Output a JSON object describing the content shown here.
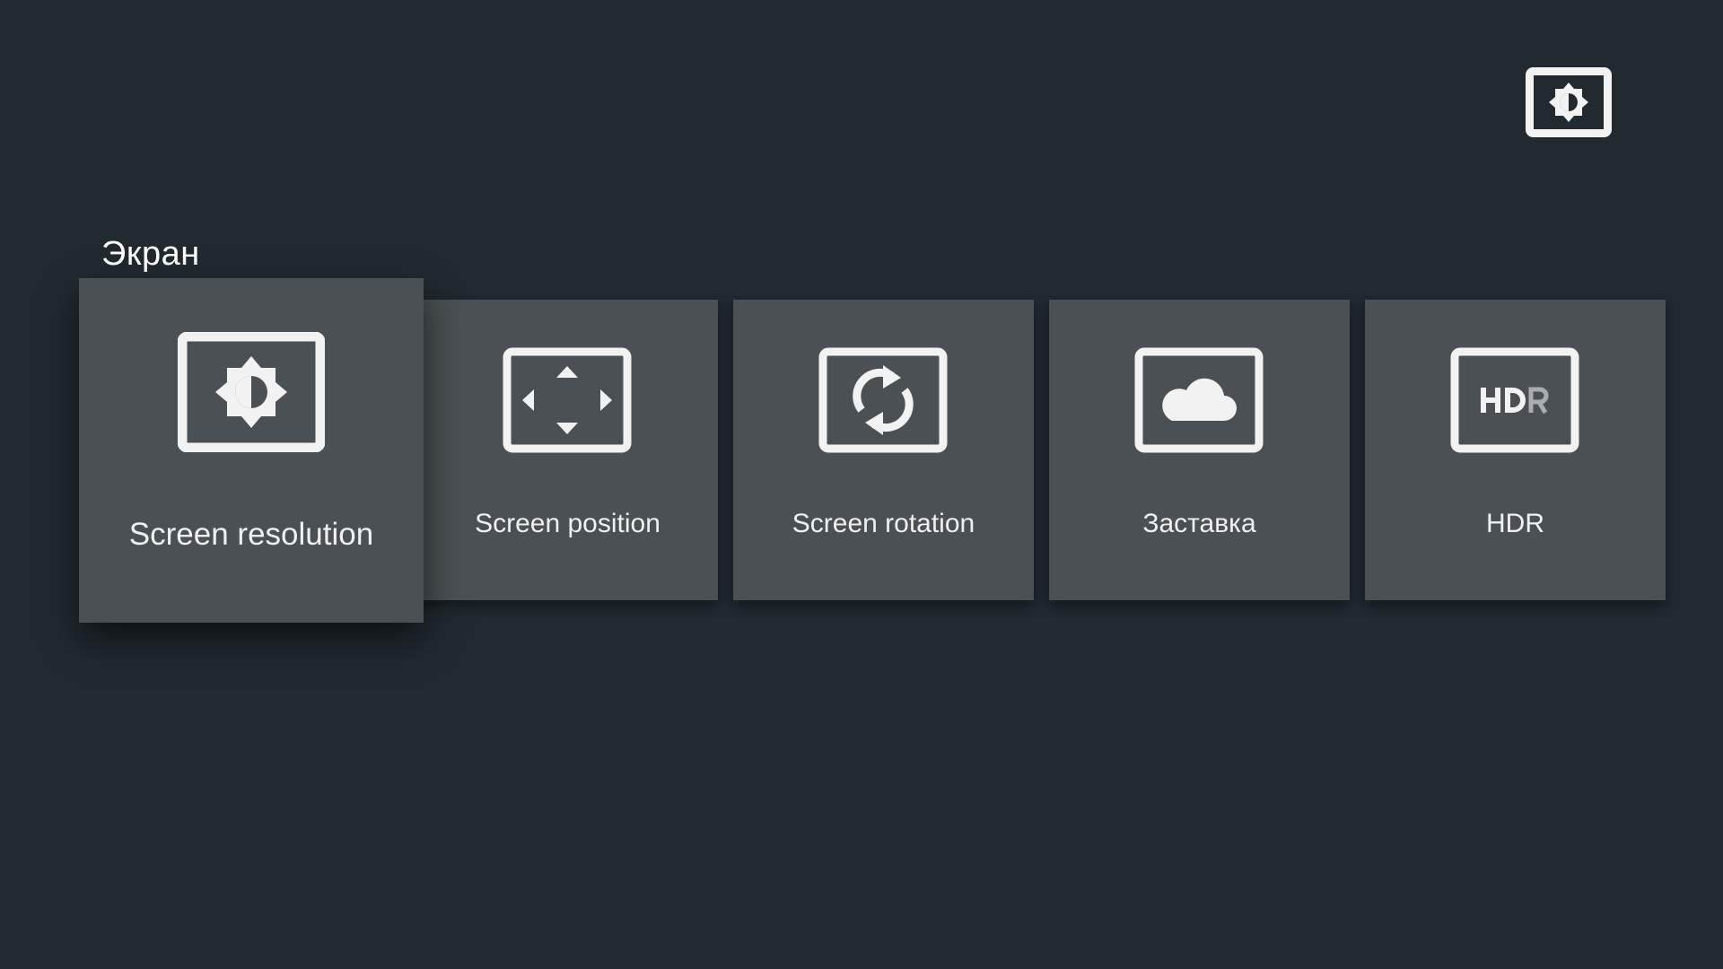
{
  "header": {
    "icon": "brightness-display-icon"
  },
  "section": {
    "title": "Экран"
  },
  "tiles": [
    {
      "label": "Screen resolution",
      "icon": "brightness-display-icon",
      "focused": true
    },
    {
      "label": "Screen position",
      "icon": "screen-position-arrows-icon",
      "focused": false
    },
    {
      "label": "Screen rotation",
      "icon": "screen-rotation-icon",
      "focused": false
    },
    {
      "label": "Заставка",
      "icon": "screensaver-cloud-icon",
      "focused": false
    },
    {
      "label": "HDR",
      "icon": "hdr-icon",
      "focused": false
    }
  ],
  "colors": {
    "background": "#222a30",
    "tile": "#4a5053",
    "text": "#ffffff"
  }
}
